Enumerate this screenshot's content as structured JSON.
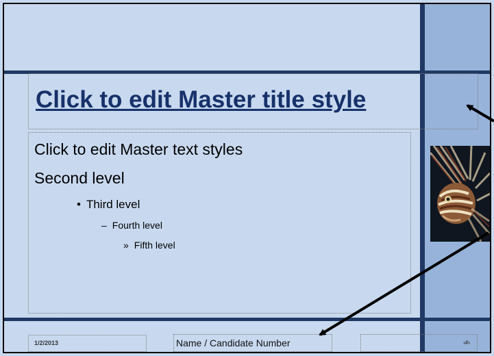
{
  "slide": {
    "title": "Click to edit Master title style",
    "body": {
      "level1": "Click to edit Master text styles",
      "level2": "Second level",
      "level3": "Third level",
      "level4": "Fourth level",
      "level5": "Fifth level"
    },
    "bullets": {
      "level3": "•",
      "level4": "–",
      "level5": "»"
    },
    "footer": {
      "date": "1/2/2013",
      "name": "Name / Candidate Number",
      "slide_number": "‹#›"
    }
  },
  "colors": {
    "background": "#c8d9ef",
    "panel": "#97b3d9",
    "bars": "#1f3864",
    "title": "#17316a"
  },
  "icons": {
    "photo": "lionfish-photo",
    "arrows": "annotation-arrow"
  }
}
